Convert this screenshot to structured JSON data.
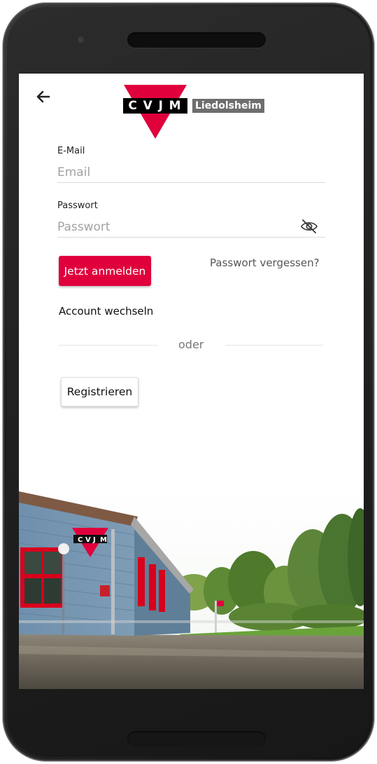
{
  "header": {
    "logo": {
      "letters": [
        "C",
        "V",
        "J",
        "M"
      ],
      "subtitle": "Liedolsheim"
    },
    "back_icon": "arrow-left-icon"
  },
  "form": {
    "email": {
      "label": "E-Mail",
      "placeholder": "Email",
      "value": ""
    },
    "password": {
      "label": "Passwort",
      "placeholder": "Passwort",
      "value": "",
      "toggle_icon": "eye-off-icon"
    },
    "login_label": "Jetzt anmelden",
    "forgot_label": "Passwort vergessen?",
    "switch_account_label": "Account wechseln",
    "divider_text": "oder",
    "register_label": "Registrieren"
  },
  "photo": {
    "sign_letters": [
      "C",
      "V",
      "J",
      "M"
    ]
  },
  "colors": {
    "brand_red": "#e0003c",
    "logo_grey": "#6e6e6e"
  }
}
